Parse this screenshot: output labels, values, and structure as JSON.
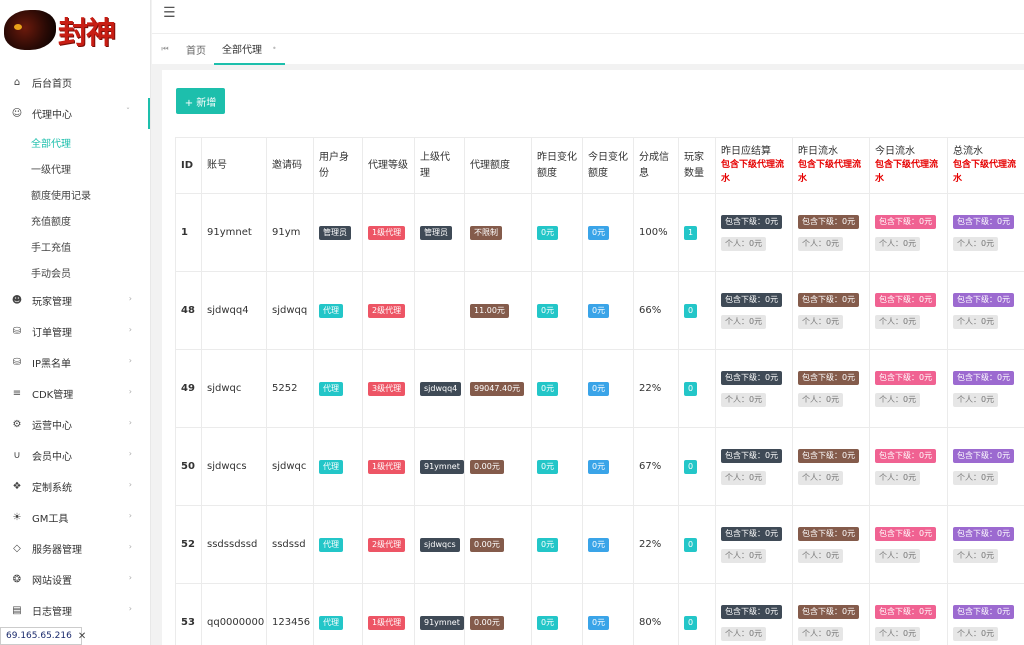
{
  "logo": {
    "text": "封神"
  },
  "topbar": {
    "menu_icon": "hamburger-icon"
  },
  "sidebar": {
    "items": [
      {
        "label": "后台首页",
        "icon": "home-icon"
      },
      {
        "label": "代理中心",
        "icon": "users-icon"
      },
      {
        "label": "玩家管理",
        "icon": "players-icon"
      },
      {
        "label": "订单管理",
        "icon": "database-icon"
      },
      {
        "label": "IP黑名单",
        "icon": "database-icon"
      },
      {
        "label": "CDK管理",
        "icon": "list-icon"
      },
      {
        "label": "运营中心",
        "icon": "gear-icon"
      },
      {
        "label": "会员中心",
        "icon": "magnet-icon"
      },
      {
        "label": "定制系统",
        "icon": "modules-icon"
      },
      {
        "label": "GM工具",
        "icon": "bulb-icon"
      },
      {
        "label": "服务器管理",
        "icon": "diamond-icon"
      },
      {
        "label": "网站设置",
        "icon": "compass-icon"
      },
      {
        "label": "日志管理",
        "icon": "message-icon"
      }
    ],
    "sub_items": [
      "全部代理",
      "一级代理",
      "额度使用记录",
      "充值额度",
      "手工充值",
      "手动会员"
    ]
  },
  "tabs": {
    "home": "首页",
    "current": "全部代理"
  },
  "toolbar": {
    "add_label": "+ 新增"
  },
  "table": {
    "headers": {
      "id": "ID",
      "account": "账号",
      "invite": "邀请码",
      "role": "用户身份",
      "level": "代理等级",
      "parent": "上级代理",
      "quota": "代理额度",
      "ychange": "昨日变化额度",
      "tchange": "今日变化额度",
      "share": "分成信息",
      "players": "玩家数量",
      "settle": "昨日应结算",
      "yflow": "昨日流水",
      "tflow": "今日流水",
      "total": "总流水",
      "note": "包含下级代理流水"
    },
    "rows": [
      {
        "id": "1",
        "account": "91ymnet",
        "invite": "91ym",
        "role": "管理员",
        "level": "1级代理",
        "parent": "管理员",
        "quota": "不限制",
        "ychange": "0元",
        "tchange": "0元",
        "share": "100%",
        "players": "1"
      },
      {
        "id": "48",
        "account": "sjdwqq4",
        "invite": "sjdwqq",
        "role": "代理",
        "level": "2级代理",
        "parent": "",
        "quota": "11.00元",
        "ychange": "0元",
        "tchange": "0元",
        "share": "66%",
        "players": "0"
      },
      {
        "id": "49",
        "account": "sjdwqc",
        "invite": "5252",
        "role": "代理",
        "level": "3级代理",
        "parent": "sjdwqq4",
        "quota": "99047.40元",
        "ychange": "0元",
        "tchange": "0元",
        "share": "22%",
        "players": "0"
      },
      {
        "id": "50",
        "account": "sjdwqcs",
        "invite": "sjdwqc",
        "role": "代理",
        "level": "1级代理",
        "parent": "91ymnet",
        "quota": "0.00元",
        "ychange": "0元",
        "tchange": "0元",
        "share": "67%",
        "players": "0"
      },
      {
        "id": "52",
        "account": "ssdssdssd",
        "invite": "ssdssd",
        "role": "代理",
        "level": "2级代理",
        "parent": "sjdwqcs",
        "quota": "0.00元",
        "ychange": "0元",
        "tchange": "0元",
        "share": "22%",
        "players": "0"
      },
      {
        "id": "53",
        "account": "qq0000000",
        "invite": "123456",
        "role": "代理",
        "level": "1级代理",
        "parent": "91ymnet",
        "quota": "0.00元",
        "ychange": "0元",
        "tchange": "0元",
        "share": "80%",
        "players": "0"
      }
    ],
    "flow": {
      "sub": "包含下级：0元",
      "self": "个人：0元"
    }
  },
  "statusbar": {
    "ip": "69.165.65.216"
  },
  "colors": {
    "accent": "#1dbfac"
  }
}
